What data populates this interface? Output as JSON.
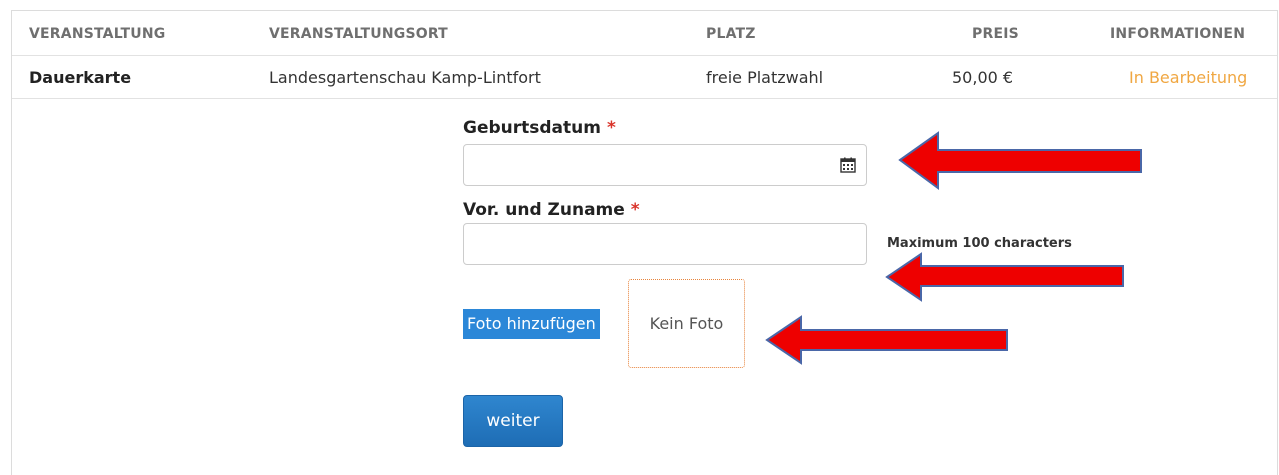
{
  "table": {
    "headers": [
      "VERANSTALTUNG",
      "VERANSTALTUNGSORT",
      "PLATZ",
      "PREIS",
      "INFORMATIONEN"
    ],
    "row": {
      "event": "Dauerkarte",
      "venue": "Landesgartenschau Kamp-Lintfort",
      "seat": "freie Platzwahl",
      "price": "50,00 €",
      "status": "In Bearbeitung"
    }
  },
  "form": {
    "birthdate": {
      "label": "Geburtsdatum",
      "required_mark": "*",
      "value": "",
      "icon": "calendar-icon"
    },
    "name": {
      "label": "Vor. und Zuname",
      "required_mark": "*",
      "value": "",
      "hint": "Maximum 100 characters"
    },
    "photo": {
      "button_label": "Foto hinzufügen",
      "placeholder_text": "Kein Foto"
    },
    "submit_label": "weiter"
  },
  "annotations": {
    "arrow_color": "#ee0000",
    "arrow_outline": "#4a67a8",
    "count": 3
  },
  "colors": {
    "status": "#f0a742",
    "required": "#d9342b",
    "primary_button": "#2b87d8",
    "photo_border": "#e8843c"
  }
}
